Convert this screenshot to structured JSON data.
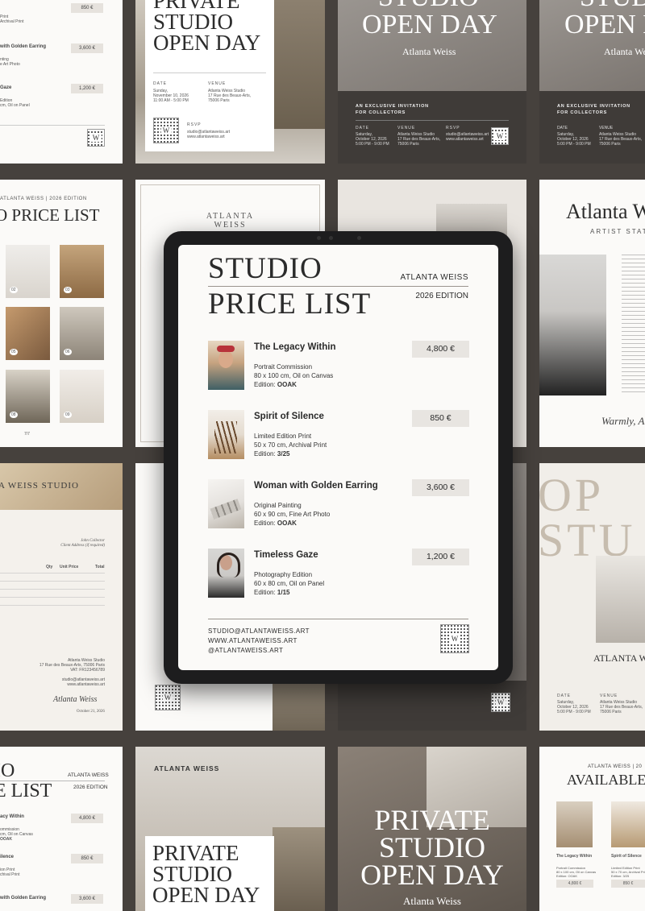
{
  "tablet": {
    "title_line1": "STUDIO",
    "title_line2": "PRICE LIST",
    "artist": "ATLANTA WEISS",
    "edition": "2026 EDITION",
    "items": [
      {
        "name": "The Legacy Within",
        "type": "Portrait Commission",
        "size": "80 x 100 cm, Oil on Canvas",
        "edition_label": "Edition: ",
        "edition": "OOAK",
        "price": "4,800 €"
      },
      {
        "name": "Spirit of Silence",
        "type": "Limited Edition Print",
        "size": "50 x 70 cm, Archival Print",
        "edition_label": "Edition: ",
        "edition": "3/25",
        "price": "850 €"
      },
      {
        "name": "Woman with Golden Earring",
        "type": "Original Painting",
        "size": "60 x 90 cm, Fine Art Photo",
        "edition_label": "Edition: ",
        "edition": "OOAK",
        "price": "3,600 €"
      },
      {
        "name": "Timeless Gaze",
        "type": "Photography Edition",
        "size": "60 x 80 cm, Oil on Panel",
        "edition_label": "Edition: ",
        "edition": "1/15",
        "price": "1,200 €"
      }
    ],
    "footer": {
      "email": "STUDIO@ATLANTAWEISS.ART",
      "website": "WWW.ATLANTAWEISS.ART",
      "handle": "@ATLANTAWEISS.ART"
    }
  },
  "bg": {
    "c1": {
      "prices": [
        "850 €",
        "3,600 €",
        "1,200 €"
      ],
      "lines": [
        "Print",
        "Archival Print",
        "with Golden Earring",
        "nting",
        "e Art Photo",
        "Gaze",
        "Edition",
        "cm, Oil on Panel"
      ]
    },
    "c2": {
      "title": "PRIVATE\nSTUDIO\nOPEN DAY",
      "date_label": "DATE",
      "date": "Sunday,\nNovember 10, 2026\n11:00 AM - 5:00 PM",
      "venue_label": "VENUE",
      "venue": "Atlanta Weiss Studio\n17 Rue des Beaux-Arts,\n75006 Paris",
      "rsvp_label": "RSVP",
      "rsvp": "studio@atlantaweiss.art\nwww.atlantaweiss.art"
    },
    "c3": {
      "title": "OPEN DAY",
      "title_top": "STUDIO",
      "name": "Atlanta Weiss",
      "invite": "AN EXCLUSIVE INVITATION\nFOR COLLECTORS",
      "date_label": "DATE",
      "date": "Saturday,\nOctober 12, 2026\n5:00 PM - 9:00 PM",
      "venue_label": "VENUE",
      "venue": "Atlanta Weiss Studio\n17 Rue des Beaux-Arts,\n75006 Paris",
      "rsvp_label": "RSVP",
      "rsvp": "studio@atlantaweiss.art\nwww.atlantaweiss.art"
    },
    "c4": {
      "title": "OPEN DAY",
      "title_top": "STUDIO",
      "name": "Atlanta Weiss",
      "invite": "AN EXCLUSIVE INVITATION\nFOR COLLECTORS",
      "date_label": "DATE",
      "date": "Saturday,\nOctober 12, 2026\n5:00 PM - 9:00 PM",
      "venue_label": "VENUE",
      "venue": "Atlanta Weiss Studio\n17 Rue des Beaux-Arts,\n75006 Paris"
    },
    "c5": {
      "header": "ATLANTA WEISS | 2026 EDITION",
      "title": "O PRICE LIST",
      "nums": [
        "02",
        "03",
        "05",
        "06",
        "08",
        "09"
      ],
      "page": "7/7"
    },
    "c6": {
      "name": "ATLANTA\nWEISS"
    },
    "c8": {
      "title": "Atlanta W",
      "subtitle": "ARTIST STAT",
      "signature": "Warmly, At"
    },
    "c9": {
      "header": "A WEISS STUDIO",
      "client": "John Collector\nClient Address (if required)",
      "col_qty": "Qty",
      "col_unit": "Unit Price",
      "col_total": "Total",
      "signature": "Atlanta Weiss",
      "date": "October 21, 2026",
      "studio": "Atlanta Weiss Studio\n17 Rue des Beaux-Arts, 75006 Paris\nVAT: FR123456789",
      "contact": "studio@atlantaweiss.art\nwww.atlantaweiss.art"
    },
    "c12": {
      "title": "OP\nSTU",
      "name": "ATLANTA WE",
      "date_label": "DATE",
      "date": "Saturday,\nOctober 12, 2026\n5:00 PM - 9:00 PM",
      "venue_label": "VENUE",
      "venue": "Atlanta Weiss Studio\n17 Rue des Beaux-Arts,\n75006 Paris"
    },
    "c13": {
      "title": "IO\nE LIST",
      "brand": "ATLANTA WEISS",
      "edition": "2026 EDITION",
      "prices": [
        "4,800 €",
        "850 €",
        "3,600 €"
      ],
      "lines": [
        "acy Within",
        "ommission",
        "cm, Oil on Canvas",
        "OOAK",
        "ilence",
        "ion Print",
        "chival Print",
        "with Golden Earring"
      ]
    },
    "c14": {
      "brand": "ATLANTA WEISS",
      "title": "PRIVATE\nSTUDIO\nOPEN DAY"
    },
    "c15": {
      "title": "PRIVATE\nSTUDIO\nOPEN DAY",
      "name": "Atlanta Weiss"
    },
    "c16": {
      "header": "ATLANTA WEISS | 20",
      "title": "AVAILABLE",
      "n1": "The Legacy Within",
      "n2": "Spirit of Silence",
      "d1": "Portrait Commission\n80 x 100 cm, Oil on Canvas\nEdition: OOAK",
      "d2": "Limited Edition Print\n50 x 70 cm, Archival Print\nEdition: 3/25",
      "p1": "4,800 €",
      "p2": "850 €"
    }
  },
  "colors": {
    "background": "#46413d",
    "chip": "#e8e5e1",
    "dark_card": "#3f3b38"
  }
}
